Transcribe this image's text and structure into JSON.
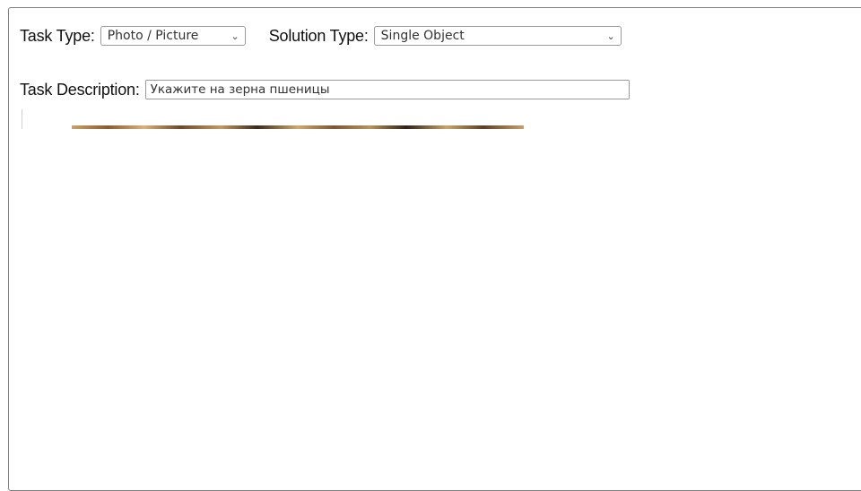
{
  "task_type": {
    "label": "Task Type:",
    "selected": "Photo / Picture"
  },
  "solution_type": {
    "label": "Solution Type:",
    "selected": "Single Object"
  },
  "task_description": {
    "label": "Task Description:",
    "value": "Укажите на зерна пшеницы"
  }
}
